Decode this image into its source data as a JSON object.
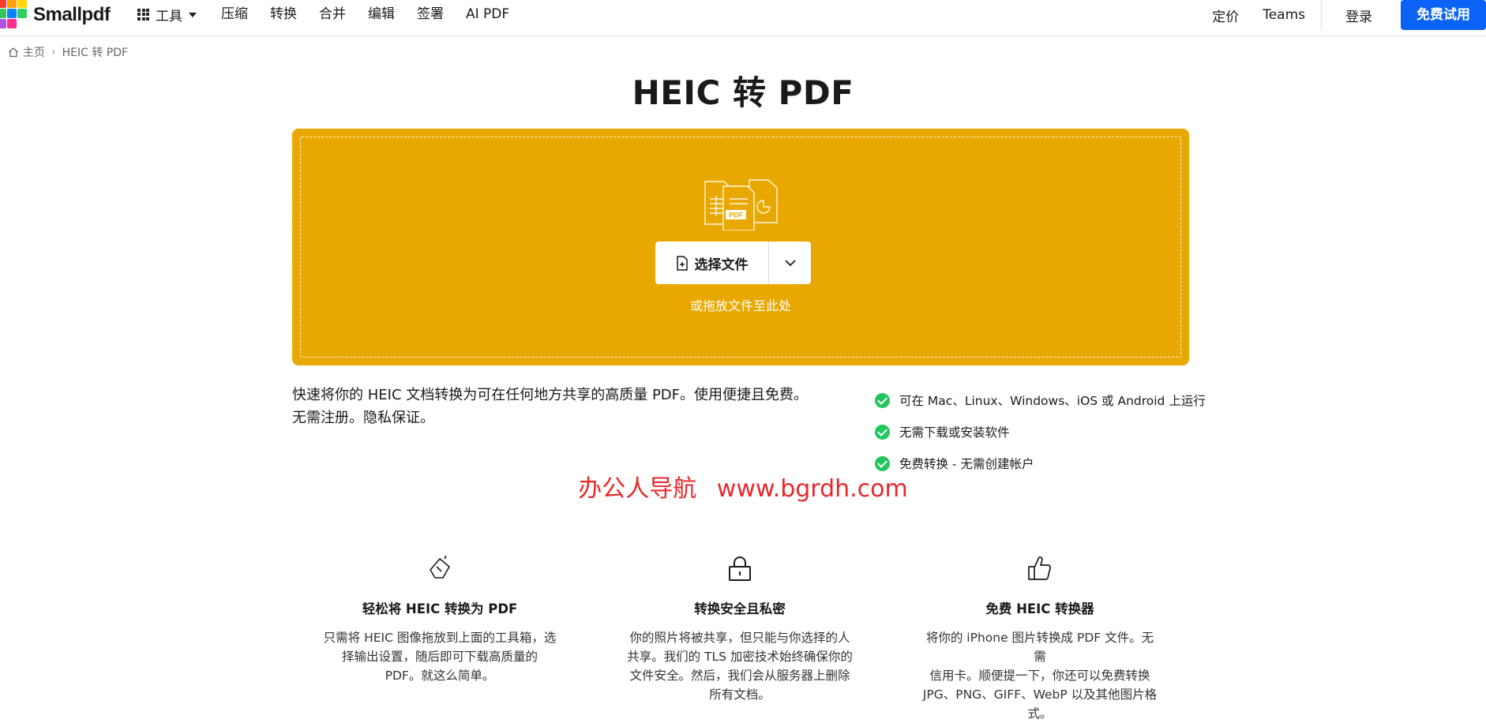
{
  "header": {
    "logo_text": "Smallpdf",
    "tools_label": "工具",
    "nav_links": [
      "压缩",
      "转换",
      "合并",
      "编辑",
      "签署",
      "AI PDF"
    ],
    "pricing": "定价",
    "teams": "Teams",
    "login": "登录",
    "free_trial": "免费试用"
  },
  "breadcrumb": {
    "home": "主页",
    "current": "HEIC 转 PDF"
  },
  "page": {
    "title": "HEIC 转 PDF"
  },
  "dropzone": {
    "illustration_badge": "PDF",
    "choose_file": "选择文件",
    "drop_hint": "或拖放文件至此处"
  },
  "description": {
    "line1": "快速将你的 HEIC 文档转换为可在任何地方共享的高质量 PDF。使用便捷且免费。",
    "line2": "无需注册。隐私保证。"
  },
  "features": [
    "可在 Mac、Linux、Windows、iOS 或 Android 上运行",
    "无需下载或安装软件",
    "免费转换 - 无需创建帐户"
  ],
  "watermark": {
    "name": "办公人导航",
    "url": "www.bgrdh.com"
  },
  "columns": [
    {
      "icon": "hand-drag-icon",
      "title": "轻松将 HEIC 转换为 PDF",
      "lines": [
        "只需将 HEIC 图像拖放到上面的工具箱，选",
        "择输出设置，随后即可下载高质量的",
        "PDF。就这么简单。"
      ]
    },
    {
      "icon": "lock-icon",
      "title": "转换安全且私密",
      "lines": [
        "你的照片将被共享，但只能与你选择的人",
        "共享。我们的 TLS 加密技术始终确保你的",
        "文件安全。然后，我们会从服务器上删除",
        "所有文档。"
      ]
    },
    {
      "icon": "thumbs-up-icon",
      "title": "免费 HEIC 转换器",
      "lines": [
        "将你的 iPhone 图片转换成 PDF 文件。无需",
        "信用卡。顺便提一下，你还可以免费转换",
        "JPG、PNG、GIFF、WebP 以及其他图片格",
        "式。"
      ]
    }
  ],
  "colors": {
    "accent": "#0a63f6",
    "dropzone": "#e8a800",
    "check": "#22c55e",
    "watermark": "#e8282b"
  }
}
